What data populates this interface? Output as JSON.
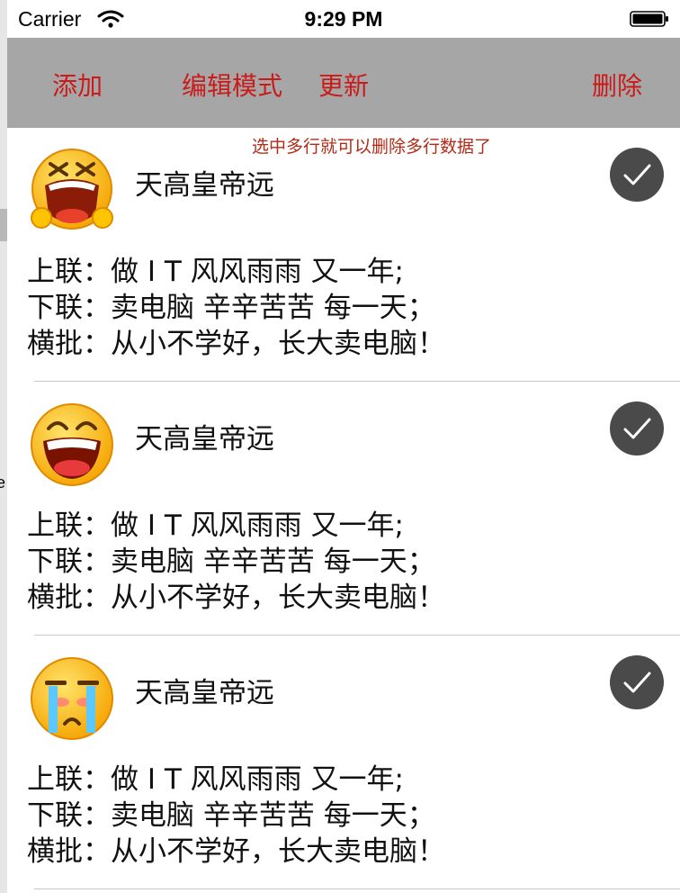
{
  "status_bar": {
    "carrier": "Carrier",
    "time": "9:29 PM"
  },
  "toolbar": {
    "add_label": "添加",
    "edit_mode_label": "编辑模式",
    "update_label": "更新",
    "delete_label": "删除"
  },
  "hint": "选中多行就可以删除多行数据了",
  "edge_letter": "e",
  "rows": [
    {
      "title": "天高皇帝远",
      "avatar": "shouting-face-icon",
      "line1": "上联：做 I T 风风雨雨 又一年;",
      "line2": "下联：卖电脑 辛辛苦苦 每一天；",
      "line3": "横批：从小不学好，长大卖电脑！",
      "selected": true
    },
    {
      "title": "天高皇帝远",
      "avatar": "laughing-face-icon",
      "line1": "上联：做 I T 风风雨雨 又一年;",
      "line2": "下联：卖电脑 辛辛苦苦 每一天；",
      "line3": "横批：从小不学好，长大卖电脑！",
      "selected": true
    },
    {
      "title": "天高皇帝远",
      "avatar": "crying-face-icon",
      "line1": "上联：做 I T 风风雨雨 又一年;",
      "line2": "下联：卖电脑 辛辛苦苦 每一天；",
      "line3": "横批：从小不学好，长大卖电脑！",
      "selected": true
    }
  ],
  "colors": {
    "toolbar_bg": "#a6a6a6",
    "toolbar_text": "#cc1a1a",
    "hint_text": "#b52a16",
    "check_bg": "#4a4a4a"
  }
}
